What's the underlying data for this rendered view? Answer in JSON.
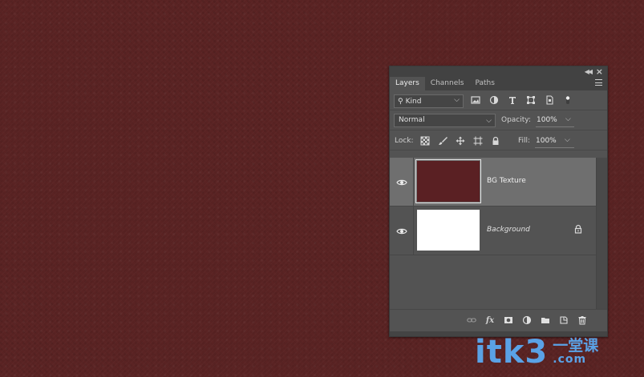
{
  "panel": {
    "tabs": [
      {
        "label": "Layers",
        "active": true
      },
      {
        "label": "Channels",
        "active": false
      },
      {
        "label": "Paths",
        "active": false
      }
    ],
    "filter": {
      "kind_label": "Kind",
      "search_icon": "search-icon"
    },
    "blend_mode": "Normal",
    "opacity_label": "Opacity:",
    "opacity_value": "100%",
    "lock_label": "Lock:",
    "fill_label": "Fill:",
    "fill_value": "100%",
    "layers": [
      {
        "name": "BG Texture",
        "visible": true,
        "selected": true,
        "thumb_color": "#5a2023",
        "locked": false
      },
      {
        "name": "Background",
        "visible": true,
        "selected": false,
        "thumb_color": "#ffffff",
        "locked": true
      }
    ]
  },
  "watermark": {
    "main": "itk3",
    "cn": "一堂课",
    "com": ".com"
  },
  "colors": {
    "canvas_bg": "#5a2323",
    "panel_bg": "#535353",
    "selected_row": "#6f6f6f",
    "watermark": "#5aa2e6"
  }
}
